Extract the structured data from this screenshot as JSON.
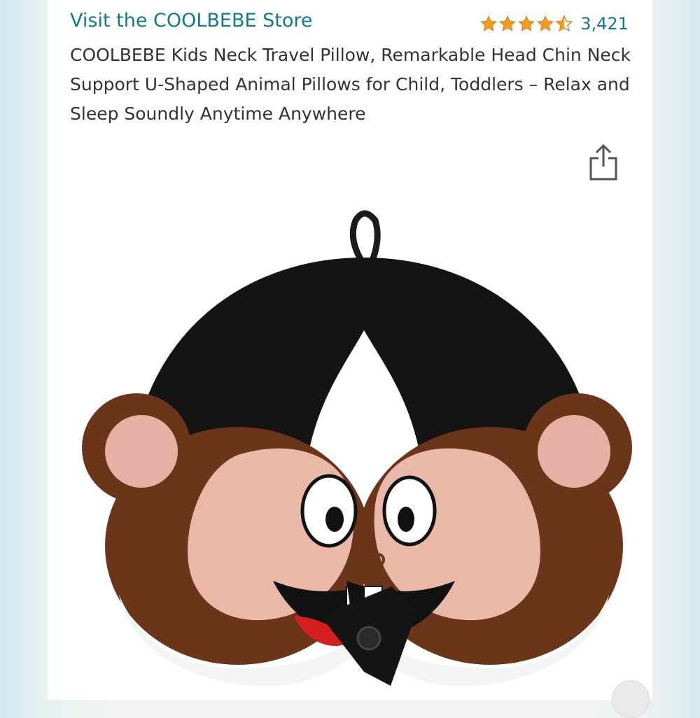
{
  "store": {
    "link_text": "Visit the COOLBEBE Store"
  },
  "rating": {
    "value": 4.5,
    "max": 5,
    "count_text": "3,421",
    "star_color": "#f39c1f"
  },
  "product": {
    "title": "COOLBEBE Kids Neck Travel Pillow, Remarkable Head Chin Neck Support U-Shaped Animal Pillows for Child, Toddlers – Relax and Sleep Soundly Anytime Anywhere"
  },
  "actions": {
    "share_icon": "share-icon"
  },
  "colors": {
    "link": "#117a8b",
    "text": "#333333",
    "accent_star": "#f39c1f"
  }
}
